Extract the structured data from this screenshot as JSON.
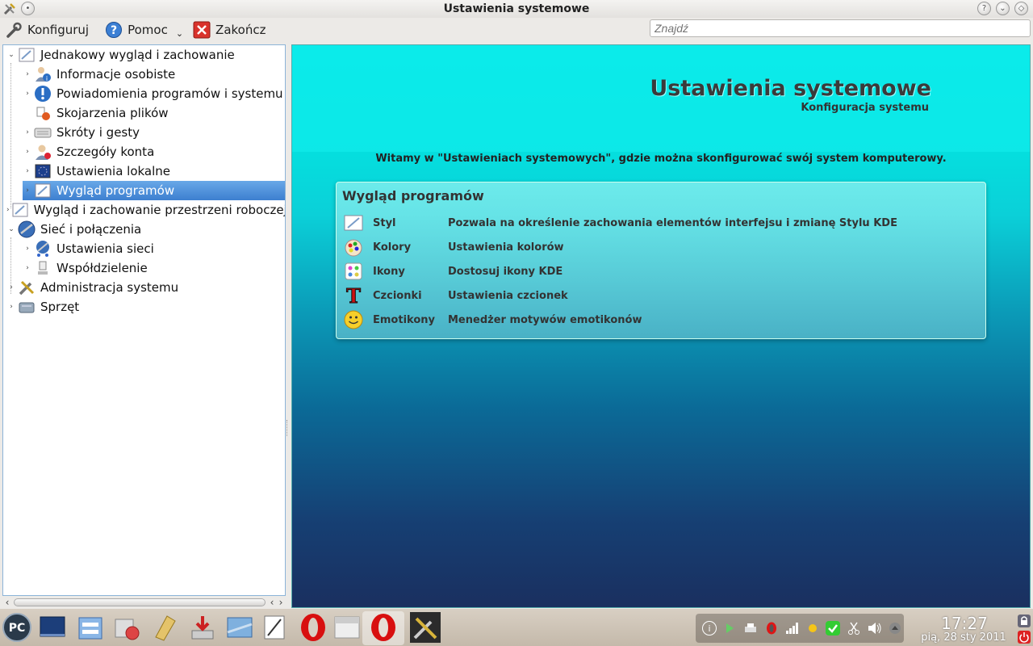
{
  "window": {
    "title": "Ustawienia systemowe"
  },
  "toolbar": {
    "configure_label": "Konfiguruj",
    "help_label": "Pomoc",
    "quit_label": "Zakończ",
    "search_placeholder": "Znajdź"
  },
  "sidebar": {
    "items": [
      {
        "label": "Jednakowy wygląd i zachowanie",
        "expander": "⌄"
      },
      {
        "label": "Informacje osobiste",
        "expander": "›"
      },
      {
        "label": "Powiadomienia programów i systemu",
        "expander": "›"
      },
      {
        "label": "Skojarzenia plików",
        "expander": ""
      },
      {
        "label": "Skróty i gesty",
        "expander": "›"
      },
      {
        "label": "Szczegóły konta",
        "expander": "›"
      },
      {
        "label": "Ustawienia lokalne",
        "expander": "›"
      },
      {
        "label": "Wygląd programów",
        "expander": "›"
      },
      {
        "label": "Wygląd i zachowanie przestrzeni roboczej",
        "expander": "›"
      },
      {
        "label": "Sieć i połączenia",
        "expander": "⌄"
      },
      {
        "label": "Ustawienia sieci",
        "expander": "›"
      },
      {
        "label": "Współdzielenie",
        "expander": "›"
      },
      {
        "label": "Administracja systemu",
        "expander": "›"
      },
      {
        "label": "Sprzęt",
        "expander": "›"
      }
    ],
    "selected_index": 7
  },
  "main": {
    "title": "Ustawienia systemowe",
    "subtitle": "Konfiguracja systemu",
    "welcome": "Witamy w \"Ustawieniach systemowych\", gdzie można skonfigurować swój system komputerowy.",
    "panel_title": "Wygląd programów",
    "modules": [
      {
        "name": "Styl",
        "desc": "Pozwala na określenie zachowania elementów interfejsu i zmianę Stylu KDE",
        "icon": "style-icon"
      },
      {
        "name": "Kolory",
        "desc": "Ustawienia kolorów",
        "icon": "colors-icon"
      },
      {
        "name": "Ikony",
        "desc": "Dostosuj ikony KDE",
        "icon": "icons-icon"
      },
      {
        "name": "Czcionki",
        "desc": "Ustawienia czcionek",
        "icon": "fonts-icon"
      },
      {
        "name": "Emotikony",
        "desc": "Menedżer motywów emotikonów",
        "icon": "emoticons-icon"
      }
    ]
  },
  "taskbar": {
    "clock_time": "17:27",
    "clock_date": "pią, 28 sty 2011"
  },
  "colors": {
    "accent": "#3d7fd0",
    "content_top": "#00e5e5",
    "content_bottom": "#1a2f5f",
    "quit_red": "#d9322b"
  }
}
